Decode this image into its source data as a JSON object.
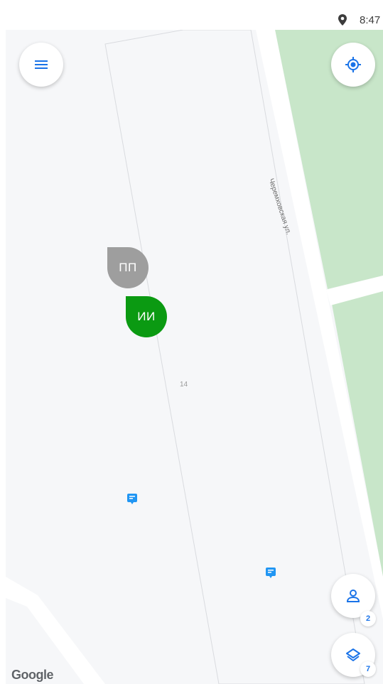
{
  "status_bar": {
    "time": "8:47",
    "location_icon": "location-pin-icon"
  },
  "map": {
    "street_label": "Черемховская ул.",
    "house_number": "14",
    "attribution": "Google",
    "colors": {
      "background": "#f6f7f9",
      "park": "#c8e6c9",
      "road": "#ffffff"
    }
  },
  "markers": [
    {
      "initials": "ПП",
      "color": "#9e9e9e"
    },
    {
      "initials": "ИИ",
      "color": "#0b9a12"
    }
  ],
  "controls": {
    "menu_icon": "hamburger-menu-icon",
    "locate_icon": "my-location-icon",
    "users_icon": "person-icon",
    "users_count": "2",
    "layers_icon": "layers-icon",
    "layers_count": "7",
    "accent": "#1a73e8"
  }
}
